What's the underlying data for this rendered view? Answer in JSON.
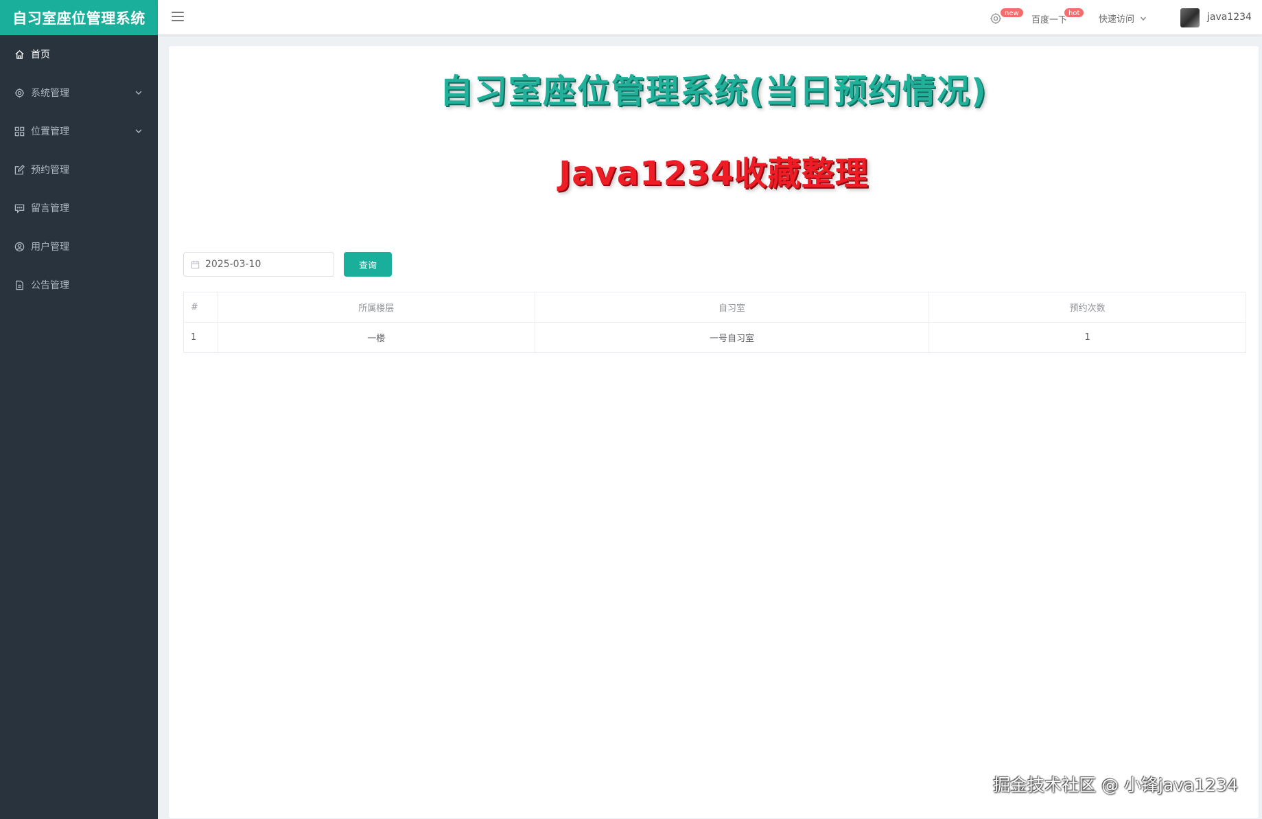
{
  "app": {
    "brand": "自习室座位管理系统"
  },
  "sidebar": {
    "items": [
      {
        "label": "首页",
        "icon": "home-icon",
        "active": true
      },
      {
        "label": "系统管理",
        "icon": "gear-icon",
        "expandable": true
      },
      {
        "label": "位置管理",
        "icon": "grid-icon",
        "expandable": true
      },
      {
        "label": "预约管理",
        "icon": "edit-icon"
      },
      {
        "label": "留言管理",
        "icon": "message-icon"
      },
      {
        "label": "用户管理",
        "icon": "user-icon"
      },
      {
        "label": "公告管理",
        "icon": "document-icon"
      }
    ]
  },
  "header": {
    "badge_new": "new",
    "badge_hot": "hot",
    "baidu_link": "百度一下",
    "quick_access": "快速访问",
    "username": "java1234"
  },
  "main": {
    "title": "自习室座位管理系统(当日预约情况)",
    "subtitle": "Java1234收藏整理",
    "date_value": "2025-03-10",
    "query_label": "查询",
    "table": {
      "headers": [
        "#",
        "所属楼层",
        "自习室",
        "预约次数"
      ],
      "rows": [
        [
          "1",
          "一楼",
          "一号自习室",
          "1"
        ]
      ]
    }
  },
  "watermark": "掘金技术社区 @ 小锋java1234",
  "colors": {
    "accent": "#1aaf9b",
    "sidebar_bg": "#28333e",
    "badge": "#f56c6c",
    "title_green": "#21b09a",
    "subtitle_red": "#ee1c25"
  }
}
